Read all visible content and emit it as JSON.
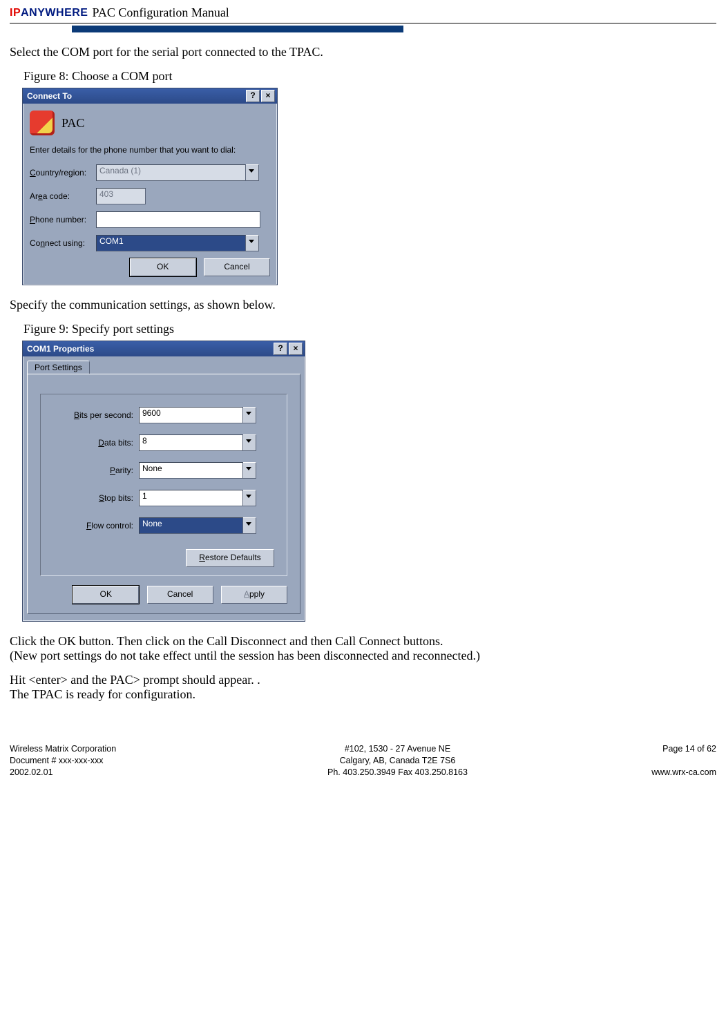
{
  "header": {
    "logo_ip": "IP",
    "logo_rest": "ANYWHERE",
    "title": "PAC Configuration Manual"
  },
  "para1": "Select the COM port for the serial port connected to the TPAC.",
  "fig8": {
    "caption": "Figure 8:  Choose a COM port",
    "title": "Connect To",
    "help_btn": "?",
    "close_btn": "×",
    "pac_label": "PAC",
    "info": "Enter details for the phone number that you want to dial:",
    "country_label": "Country/region:",
    "country_value": "Canada (1)",
    "area_label": "Area code:",
    "area_value": "403",
    "phone_label": "Phone number:",
    "phone_value": "",
    "connect_label": "Connect using:",
    "connect_value": "COM1",
    "ok": "OK",
    "cancel": "Cancel"
  },
  "para2": "Specify the communication settings, as shown below.",
  "fig9": {
    "caption": "Figure 9:  Specify port settings",
    "title": "COM1 Properties",
    "help_btn": "?",
    "close_btn": "×",
    "tab": "Port Settings",
    "bits_label": "Bits per second:",
    "bits_value": "9600",
    "data_label": "Data bits:",
    "data_value": "8",
    "parity_label": "Parity:",
    "parity_value": "None",
    "stop_label": "Stop bits:",
    "stop_value": "1",
    "flow_label": "Flow control:",
    "flow_value": "None",
    "restore": "Restore Defaults",
    "ok": "OK",
    "cancel": "Cancel",
    "apply": "Apply"
  },
  "para3a": "Click the OK button.  Then click on the Call Disconnect and then Call Connect buttons.",
  "para3b": "(New port settings do not take effect until the session has been disconnected and reconnected.)",
  "para4": "Hit <enter> and the PAC> prompt should appear. .",
  "para5": "The TPAC is ready for configuration.",
  "footer": {
    "l1": "Wireless Matrix Corporation",
    "l2": "Document # xxx-xxx-xxx",
    "l3": "2002.02.01",
    "c1": "#102, 1530 - 27 Avenue NE",
    "c2": "Calgary, AB, Canada  T2E 7S6",
    "c3": "Ph. 403.250.3949  Fax 403.250.8163",
    "r1": "Page 14 of 62",
    "r2": "www.wrx-ca.com"
  }
}
